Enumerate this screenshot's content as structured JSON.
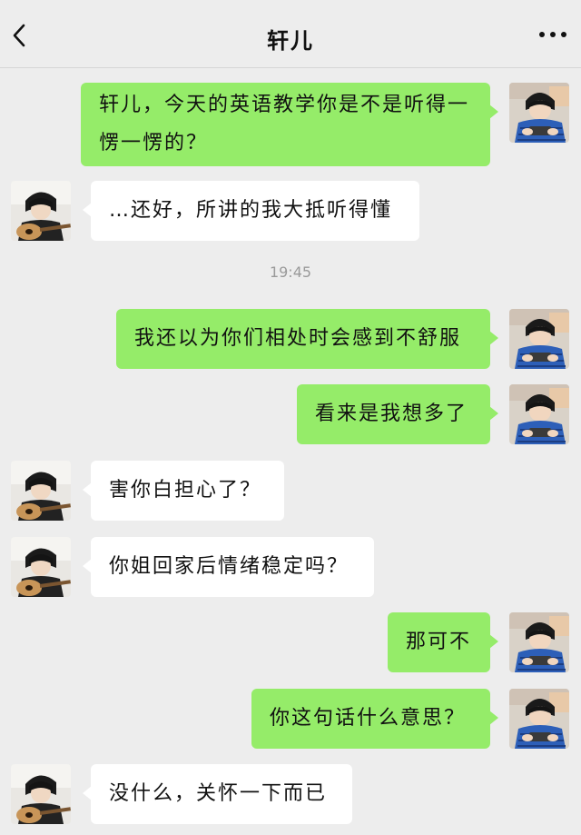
{
  "header": {
    "title": "轩儿"
  },
  "timestamp": "19:45",
  "messages": [
    {
      "sender": "me",
      "text": "轩儿，今天的英语教学你是不是听得一愣一愣的？"
    },
    {
      "sender": "other",
      "text": "…还好，所讲的我大抵听得懂"
    },
    {
      "sender": "me",
      "text": "我还以为你们相处时会感到不舒服"
    },
    {
      "sender": "me",
      "text": "看来是我想多了"
    },
    {
      "sender": "other",
      "text": "害你白担心了？"
    },
    {
      "sender": "other",
      "text": "你姐回家后情绪稳定吗？"
    },
    {
      "sender": "me",
      "text": "那可不"
    },
    {
      "sender": "me",
      "text": "你这句话什么意思？"
    },
    {
      "sender": "other",
      "text": "没什么，关怀一下而已"
    }
  ],
  "icons": {
    "back": "chevron-left-icon",
    "more": "ellipsis-icon",
    "avatar_me": "avatar-boy-phone",
    "avatar_other": "avatar-boy-guitar"
  },
  "colors": {
    "background": "#ededed",
    "my_bubble": "#95ec69",
    "other_bubble": "#ffffff",
    "timestamp": "#9a9a9a"
  }
}
